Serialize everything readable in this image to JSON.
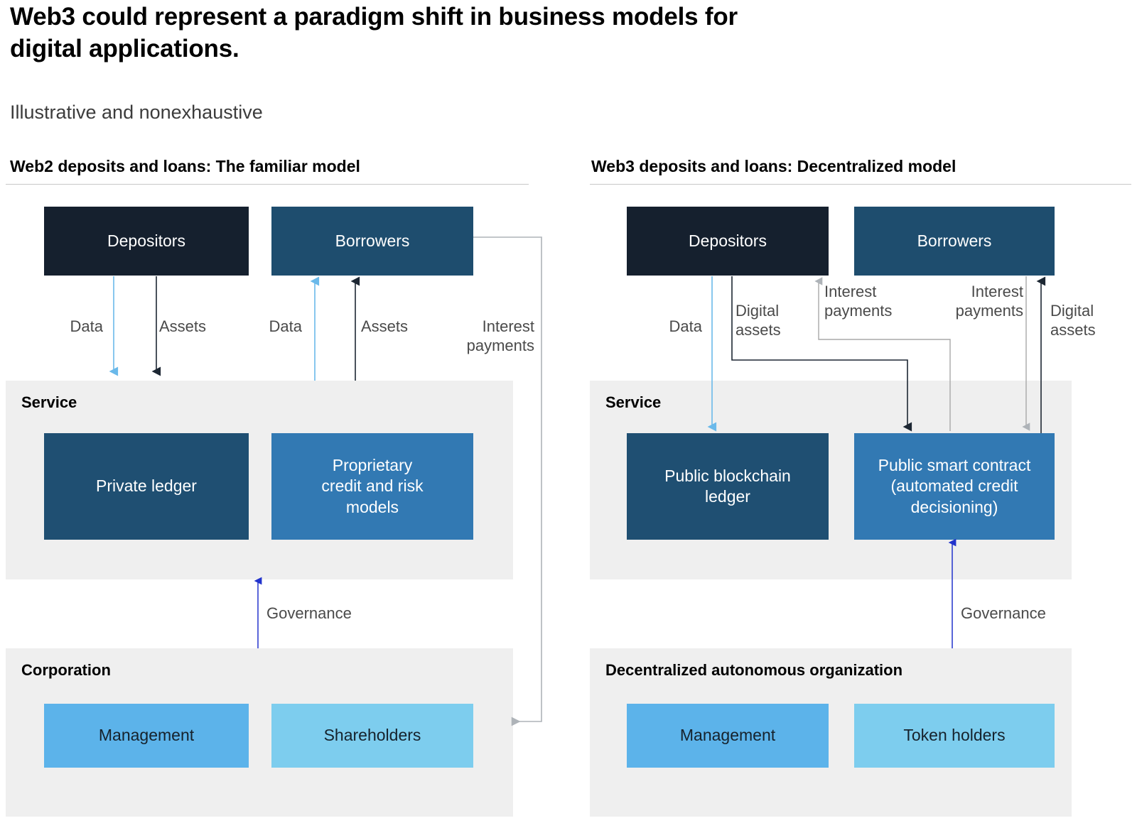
{
  "header": {
    "title": "Web3 could represent a paradigm shift in business models for\ndigital applications.",
    "subtitle": "Illustrative and nonexhaustive"
  },
  "colors": {
    "navy": "#15202e",
    "steel": "#1e4d6e",
    "deep_blue": "#1f4f72",
    "mid_blue": "#3279b3",
    "light_blue": "#5cb3ea",
    "pale_blue": "#7dcdee",
    "group_gray": "#efefef",
    "arrow_black": "#1d2733",
    "arrow_lightblue": "#6ab9ea",
    "arrow_gray": "#a8a8a8",
    "arrow_thin_gray": "#8d8d8d",
    "arrow_blue": "#2233cc",
    "label_gray": "#4a4a4a"
  },
  "panels": [
    {
      "id": "web2",
      "section_title": "Web2 deposits and loans: The familiar model",
      "actors": [
        {
          "name": "depositors",
          "label": "Depositors",
          "style": "navy"
        },
        {
          "name": "borrowers",
          "label": "Borrowers",
          "style": "steel"
        }
      ],
      "service": {
        "label": "Service",
        "nodes": [
          {
            "name": "private-ledger",
            "label": "Private ledger",
            "style": "deep_blue"
          },
          {
            "name": "proprietary-models",
            "label": "Proprietary\ncredit and risk\nmodels",
            "style": "mid_blue"
          }
        ]
      },
      "org": {
        "label": "Corporation",
        "nodes": [
          {
            "name": "management",
            "label": "Management",
            "style": "light_blue"
          },
          {
            "name": "shareholders",
            "label": "Shareholders",
            "style": "pale_blue"
          }
        ]
      },
      "flows": [
        {
          "name": "flow-depositors-data",
          "label": "Data",
          "color": "arrow_lightblue",
          "from": "Depositors",
          "to": "Service"
        },
        {
          "name": "flow-depositors-assets",
          "label": "Assets",
          "color": "arrow_black",
          "from": "Depositors",
          "to": "Service"
        },
        {
          "name": "flow-borrowers-data",
          "label": "Data",
          "color": "arrow_lightblue",
          "from": "Service",
          "to": "Borrowers"
        },
        {
          "name": "flow-borrowers-assets",
          "label": "Assets",
          "color": "arrow_black",
          "from": "Service",
          "to": "Borrowers"
        },
        {
          "name": "flow-interest-payments",
          "label": "Interest\npayments",
          "color": "arrow_gray",
          "from": "Borrowers",
          "to": "Shareholders"
        },
        {
          "name": "flow-governance",
          "label": "Governance",
          "color": "arrow_blue",
          "from": "Corporation",
          "to": "Service"
        }
      ]
    },
    {
      "id": "web3",
      "section_title": "Web3 deposits and loans: Decentralized model",
      "actors": [
        {
          "name": "depositors",
          "label": "Depositors",
          "style": "navy"
        },
        {
          "name": "borrowers",
          "label": "Borrowers",
          "style": "steel"
        }
      ],
      "service": {
        "label": "Service",
        "nodes": [
          {
            "name": "public-blockchain-ledger",
            "label": "Public blockchain\nledger",
            "style": "deep_blue"
          },
          {
            "name": "public-smart-contract",
            "label": "Public smart contract\n(automated credit\ndecisioning)",
            "style": "mid_blue"
          }
        ]
      },
      "org": {
        "label": "Decentralized autonomous organization",
        "nodes": [
          {
            "name": "management",
            "label": "Management",
            "style": "light_blue"
          },
          {
            "name": "token-holders",
            "label": "Token holders",
            "style": "pale_blue"
          }
        ]
      },
      "flows": [
        {
          "name": "flow-depositors-data",
          "label": "Data",
          "color": "arrow_lightblue",
          "from": "Depositors",
          "to": "Public blockchain ledger"
        },
        {
          "name": "flow-depositors-digital-assets",
          "label": "Digital\nassets",
          "color": "arrow_black",
          "from": "Depositors",
          "to": "Public smart contract"
        },
        {
          "name": "flow-interest-payments-depositors",
          "label": "Interest\npayments",
          "color": "arrow_gray",
          "from": "Public smart contract",
          "to": "Depositors"
        },
        {
          "name": "flow-interest-payments-borrowers",
          "label": "Interest\npayments",
          "color": "arrow_gray",
          "from": "Borrowers",
          "to": "Public smart contract"
        },
        {
          "name": "flow-borrowers-digital-assets",
          "label": "Digital\nassets",
          "color": "arrow_black",
          "from": "Public smart contract",
          "to": "Borrowers"
        },
        {
          "name": "flow-governance",
          "label": "Governance",
          "color": "arrow_blue",
          "from": "Decentralized autonomous organization",
          "to": "Public smart contract"
        }
      ]
    }
  ]
}
